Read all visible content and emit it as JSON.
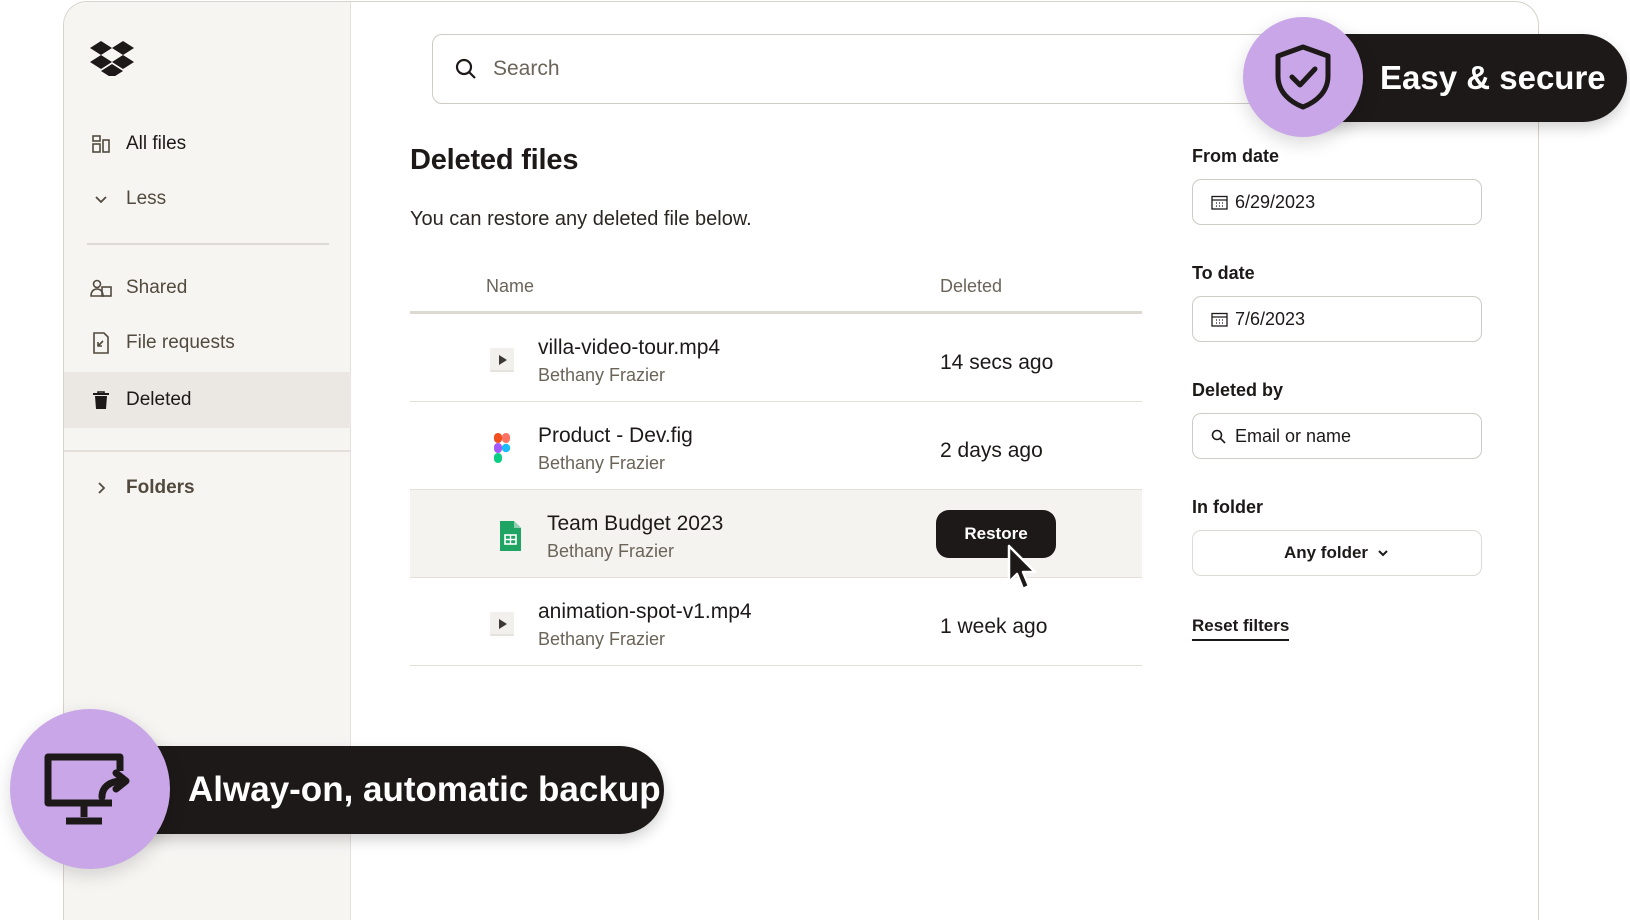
{
  "sidebar": {
    "items": [
      {
        "label": "All files",
        "icon": "all-files-icon"
      },
      {
        "label": "Less",
        "icon": "chevron-down-icon"
      },
      {
        "label": "Shared",
        "icon": "shared-icon"
      },
      {
        "label": "File requests",
        "icon": "file-request-icon"
      },
      {
        "label": "Deleted",
        "icon": "trash-icon",
        "active": true
      },
      {
        "label": "Folders",
        "icon": "chevron-right-icon"
      }
    ]
  },
  "search": {
    "placeholder": "Search"
  },
  "main": {
    "title": "Deleted files",
    "subtitle": "You can restore any deleted file below.",
    "columns": {
      "name": "Name",
      "deleted": "Deleted"
    },
    "rows": [
      {
        "name": "villa-video-tour.mp4",
        "owner": "Bethany Frazier",
        "deleted": "14 secs ago",
        "icon": "video-file-icon"
      },
      {
        "name": "Product - Dev.fig",
        "owner": "Bethany Frazier",
        "deleted": "2 days ago",
        "icon": "figma-file-icon"
      },
      {
        "name": "Team Budget 2023",
        "owner": "Bethany Frazier",
        "deleted": "",
        "icon": "spreadsheet-file-icon",
        "action": "Restore"
      },
      {
        "name": "animation-spot-v1.mp4",
        "owner": "Bethany Frazier",
        "deleted": "1 week ago",
        "icon": "video-file-icon"
      }
    ]
  },
  "filters": {
    "from_date_label": "From date",
    "from_date": "6/29/2023",
    "to_date_label": "To date",
    "to_date": "7/6/2023",
    "deleted_by_label": "Deleted by",
    "deleted_by_placeholder": "Email or name",
    "in_folder_label": "In folder",
    "in_folder_value": "Any folder",
    "reset": "Reset filters"
  },
  "callouts": {
    "secure": "Easy & secure",
    "backup": "Alway-on, automatic backup"
  },
  "colors": {
    "accent_purple": "#c8a6e8",
    "dark": "#1e1919",
    "sheet_green": "#1fa463"
  }
}
